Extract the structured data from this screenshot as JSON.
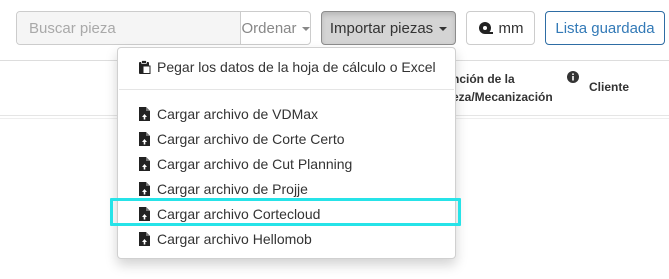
{
  "toolbar": {
    "search_placeholder": "Buscar pieza",
    "sort_label": "Ordenar",
    "import_label": "Importar piezas",
    "unit_label": "mm",
    "saved_list_label": "Lista guardada"
  },
  "table_header": {
    "function_line1": "nción de la",
    "function_line2": "eza/Mecanización",
    "client": "Cliente"
  },
  "import_menu": {
    "paste_item": "Pegar los datos de la hoja de cálculo o Excel",
    "items": [
      {
        "label": "Cargar archivo de VDMax"
      },
      {
        "label": "Cargar archivo de Corte Certo"
      },
      {
        "label": "Cargar archivo de Cut Planning"
      },
      {
        "label": "Cargar archivo de Projje"
      },
      {
        "label": "Cargar archivo Cortecloud",
        "highlighted": true
      },
      {
        "label": "Cargar archivo Hellomob"
      }
    ]
  },
  "colors": {
    "highlight": "#26e3e8",
    "primary_link": "#337ab7",
    "active_button_bg": "#d4d4d4"
  },
  "icons": {
    "paste": "clipboard-icon",
    "upload": "file-upload-icon",
    "unit": "ruler-tape-icon",
    "info": "info-circle-icon"
  }
}
